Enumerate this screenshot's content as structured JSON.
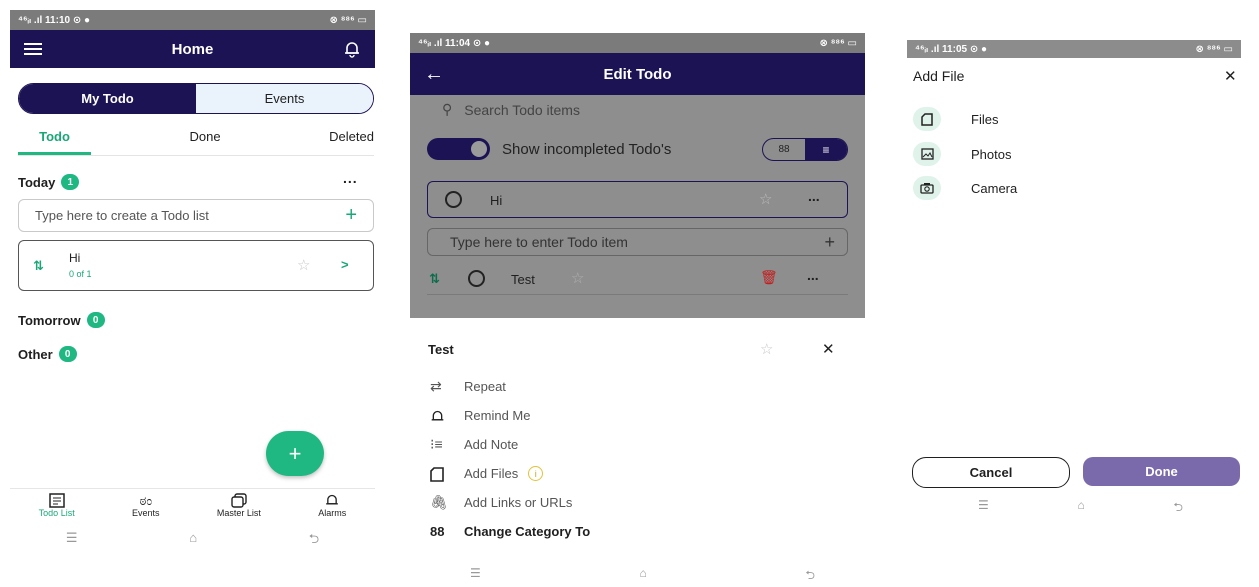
{
  "panel1": {
    "status_left": "⁴⁶ᵢₗ .ıl 11:10 ⊙ ●",
    "status_right": "⊗ ⁸⁸⁶ ▭",
    "title": "Home",
    "segment": [
      "My Todo",
      "Events"
    ],
    "tabs": [
      "Todo",
      "Done",
      "Deleted"
    ],
    "today_label": "Today",
    "today_count": "1",
    "more": "...",
    "create_placeholder": "Type here to create a Todo list",
    "plus": "+",
    "todo_title": "Hi",
    "todo_progress": "0 of 1",
    "chevron": ">",
    "tomorrow_label": "Tomorrow",
    "tomorrow_count": "0",
    "other_label": "Other",
    "other_count": "0",
    "fab": "+",
    "bottom_nav": [
      "Todo List",
      "Events",
      "Master List",
      "Alarms"
    ]
  },
  "panel2": {
    "status_left": "⁴⁶ᵢₗ .ıl 11:04 ⊙ ●",
    "status_right": "⊗ ⁸⁸⁶ ▭",
    "title": "Edit Todo",
    "search_placeholder": "Search Todo items",
    "toggle_label": "Show incompleted Todo's",
    "item_title": "Hi",
    "more": "...",
    "enter_placeholder": "Type here to enter Todo item",
    "plus": "+",
    "sub_item": "Test",
    "sheet_title": "Test",
    "close": "✕",
    "menu": [
      "Repeat",
      "Remind Me",
      "Add Note",
      "Add Files",
      "Add Links or URLs",
      "Change Category To"
    ],
    "info_mark": "i"
  },
  "panel3": {
    "status_left": "⁴⁶ᵢₗ .ıl 11:05 ⊙ ●",
    "status_right": "⊗ ⁸⁸⁶ ▭",
    "title": "Add File",
    "close": "✕",
    "options": [
      "Files",
      "Photos",
      "Camera"
    ],
    "cancel": "Cancel",
    "done": "Done"
  },
  "colors": {
    "navy": "#1c1355",
    "green": "#1fb883",
    "purple": "#7a6aab",
    "mint": "#dff3ea"
  }
}
